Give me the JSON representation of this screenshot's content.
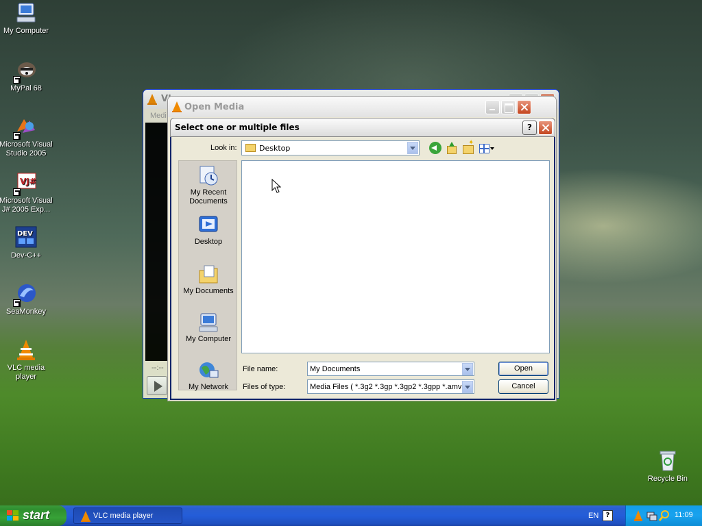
{
  "desktop": {
    "icons": [
      {
        "label": "My Computer"
      },
      {
        "label": "MyPal 68"
      },
      {
        "label": "Microsoft Visual Studio 2005"
      },
      {
        "label": "Microsoft Visual J# 2005 Exp..."
      },
      {
        "label": "Dev-C++"
      },
      {
        "label": "SeaMonkey"
      },
      {
        "label": "VLC media player"
      },
      {
        "label": "Recycle Bin"
      }
    ]
  },
  "vlc_window": {
    "title_fragment": "VL",
    "menu_fragment": "Medi",
    "time_display": "--:--"
  },
  "open_media": {
    "title": "Open Media"
  },
  "file_dialog": {
    "title": "Select one or multiple files",
    "help_label": "?",
    "look_in_label": "Look in:",
    "look_in_value": "Desktop",
    "places": [
      {
        "label": "My Recent Documents"
      },
      {
        "label": "Desktop"
      },
      {
        "label": "My Documents"
      },
      {
        "label": "My Computer"
      },
      {
        "label": "My Network"
      }
    ],
    "file_name_label": "File name:",
    "file_name_value": "My Documents",
    "files_of_type_label": "Files of type:",
    "files_of_type_value": "Media Files ( *.3g2 *.3gp *.3gp2 *.3gpp *.amv *.",
    "open_label": "Open",
    "cancel_label": "Cancel"
  },
  "taskbar": {
    "start_label": "start",
    "task_label": "VLC media player",
    "language": "EN",
    "help_glyph": "?",
    "clock": "11:09"
  },
  "colors": {
    "taskbar_blue": "#245dd8",
    "start_green": "#37a237",
    "tray_blue": "#18a2ee",
    "vlc_orange": "#f08a00"
  }
}
